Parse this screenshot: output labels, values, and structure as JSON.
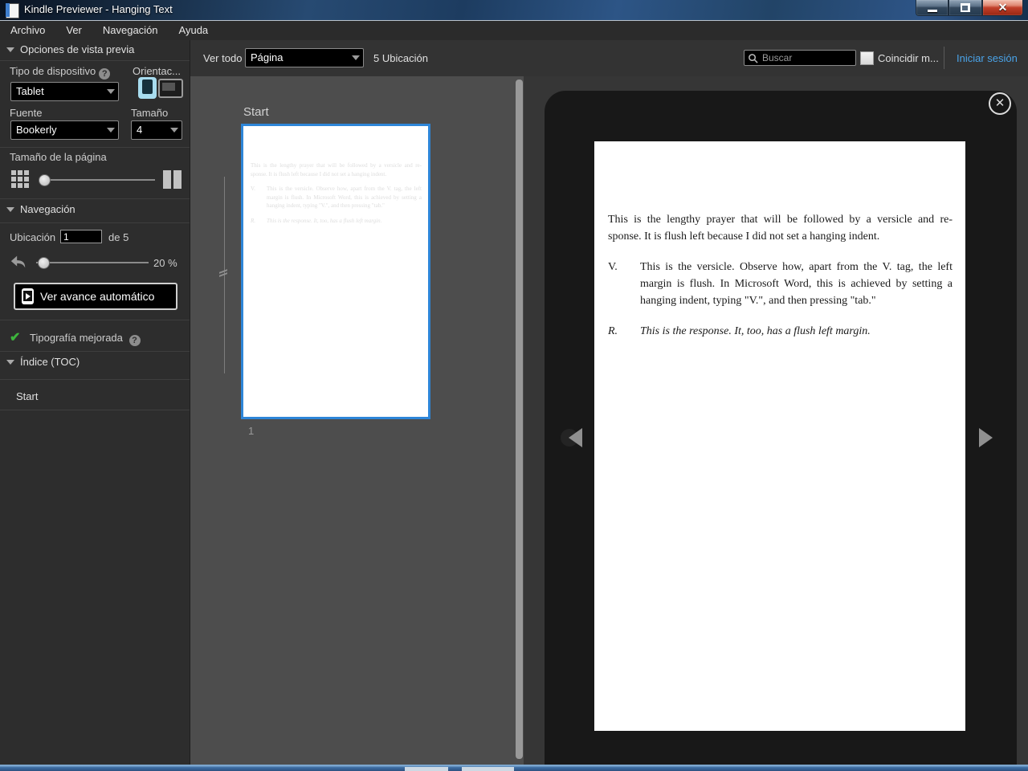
{
  "window": {
    "title": "Kindle Previewer - Hanging Text"
  },
  "menubar": {
    "items": [
      {
        "label": "Archivo"
      },
      {
        "label": "Ver"
      },
      {
        "label": "Navegación"
      },
      {
        "label": "Ayuda"
      }
    ]
  },
  "toolbar": {
    "view_all_label": "Ver todo",
    "view_mode_value": "Página",
    "location_count": "5 Ubicación",
    "search_placeholder": "Buscar",
    "match_case_label": "Coincidir m...",
    "sign_in_label": "Iniciar sesión"
  },
  "sidebar": {
    "preview_options_header": "Opciones de vista previa",
    "device_type_label": "Tipo de dispositivo",
    "orientation_label": "Orientac...",
    "device_type_value": "Tablet",
    "font_label": "Fuente",
    "size_label": "Tamaño",
    "font_value": "Bookerly",
    "size_value": "4",
    "page_size_label": "Tamaño de la página",
    "navigation_header": "Navegación",
    "location_label": "Ubicación",
    "location_value": "1",
    "location_total_label": "de 5",
    "progress_label": "20 %",
    "auto_advance_label": "Ver avance automático",
    "enhanced_typography_label": "Tipografía mejorada",
    "toc_header": "Índice (TOC)",
    "toc_items": [
      {
        "label": "Start"
      }
    ]
  },
  "thumbnails": {
    "section_label": "Start",
    "page_number": "1"
  },
  "book_page": {
    "paragraphs": [
      {
        "tag": "",
        "italic": false,
        "lines": [
          "This is the lengthy prayer that will be followed by a versicle and re-",
          "sponse. It is flush left because I did not set a hanging indent."
        ]
      },
      {
        "tag": "V.",
        "italic": false,
        "lines": [
          "This is the versicle. Observe how, apart from the V. tag, the left",
          "margin is flush. In Microsoft Word, this is achieved by setting a",
          "hanging indent, typing \"V.\", and then pressing \"tab.\""
        ]
      },
      {
        "tag": "R.",
        "italic": true,
        "lines": [
          "This is the response. It, too, has a flush left margin."
        ]
      }
    ]
  },
  "colors": {
    "accent_blue": "#2e86d8",
    "link_blue": "#4aa3e8",
    "check_green": "#3db53d"
  }
}
